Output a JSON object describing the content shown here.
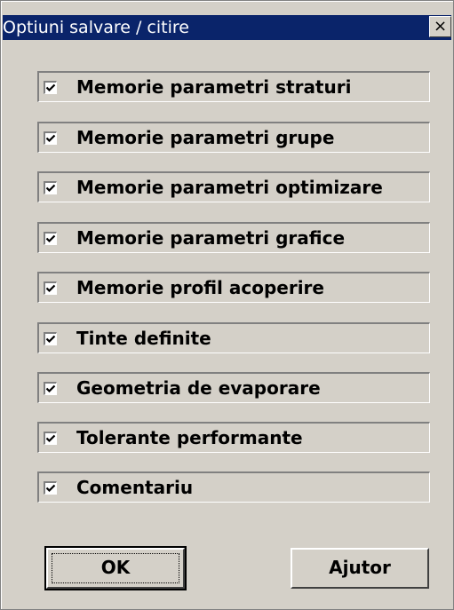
{
  "window": {
    "title": "Optiuni salvare / citire",
    "close_label": "×"
  },
  "options": [
    {
      "label": "Memorie parametri straturi",
      "checked": true
    },
    {
      "label": "Memorie parametri grupe",
      "checked": true
    },
    {
      "label": "Memorie parametri optimizare",
      "checked": true
    },
    {
      "label": "Memorie parametri grafice",
      "checked": true
    },
    {
      "label": "Memorie profil acoperire",
      "checked": true
    },
    {
      "label": "Tinte definite",
      "checked": true
    },
    {
      "label": "Geometria de evaporare",
      "checked": true
    },
    {
      "label": "Tolerante performante",
      "checked": true
    },
    {
      "label": "Comentariu",
      "checked": true
    }
  ],
  "buttons": {
    "ok_label": "OK",
    "help_label": "Ajutor"
  },
  "colors": {
    "title_bar": "#0a246a",
    "face": "#d4d0c8"
  }
}
